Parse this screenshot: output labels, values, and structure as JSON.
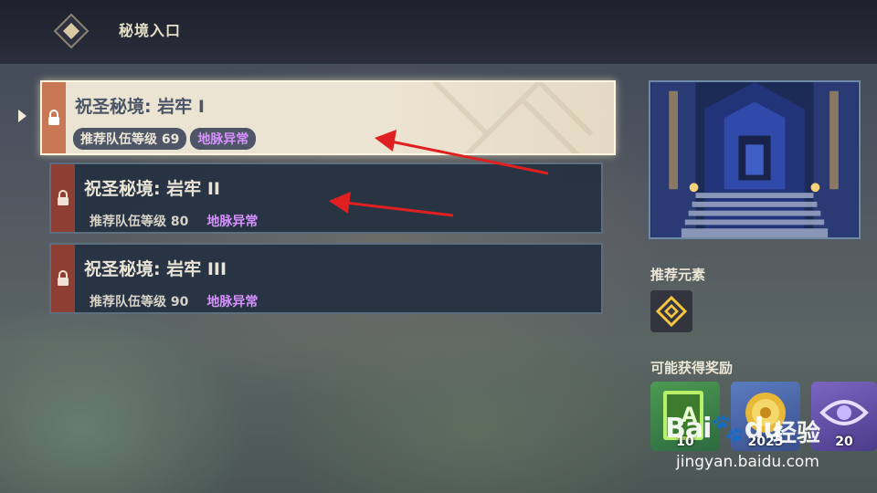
{
  "header": {
    "title": "秘境入口",
    "icon": "diamond-icon"
  },
  "domains": [
    {
      "title": "祝圣秘境: 岩牢 I",
      "level_label": "推荐队伍等级 69",
      "anomaly_label": "地脉异常",
      "selected": true,
      "locked": true
    },
    {
      "title": "祝圣秘境: 岩牢 II",
      "level_label": "推荐队伍等级 80",
      "anomaly_label": "地脉异常",
      "selected": false,
      "locked": true
    },
    {
      "title": "祝圣秘境: 岩牢 III",
      "level_label": "推荐队伍等级 90",
      "anomaly_label": "地脉异常",
      "selected": false,
      "locked": true
    }
  ],
  "sidebar": {
    "recommended_elements_label": "推荐元素",
    "recommended_element_icon": "geo-element-icon",
    "rewards_label": "可能获得奖励",
    "rewards": [
      {
        "icon": "exp-book-icon",
        "quantity": "10"
      },
      {
        "icon": "mora-coin-icon",
        "quantity": "2025"
      },
      {
        "icon": "friendship-exp-icon",
        "quantity": "20"
      }
    ]
  },
  "watermark": {
    "logo_text": "Bai",
    "logo_text_2": "du",
    "jingyan": "经验",
    "url": "jingyan.baidu.com"
  },
  "colors": {
    "selected_bg": "#ece4d2",
    "lock_strip_selected": "#c97855",
    "lock_strip_normal": "#8e3f33",
    "anomaly_text": "#d890ff",
    "annotation_arrow": "#e02020"
  }
}
